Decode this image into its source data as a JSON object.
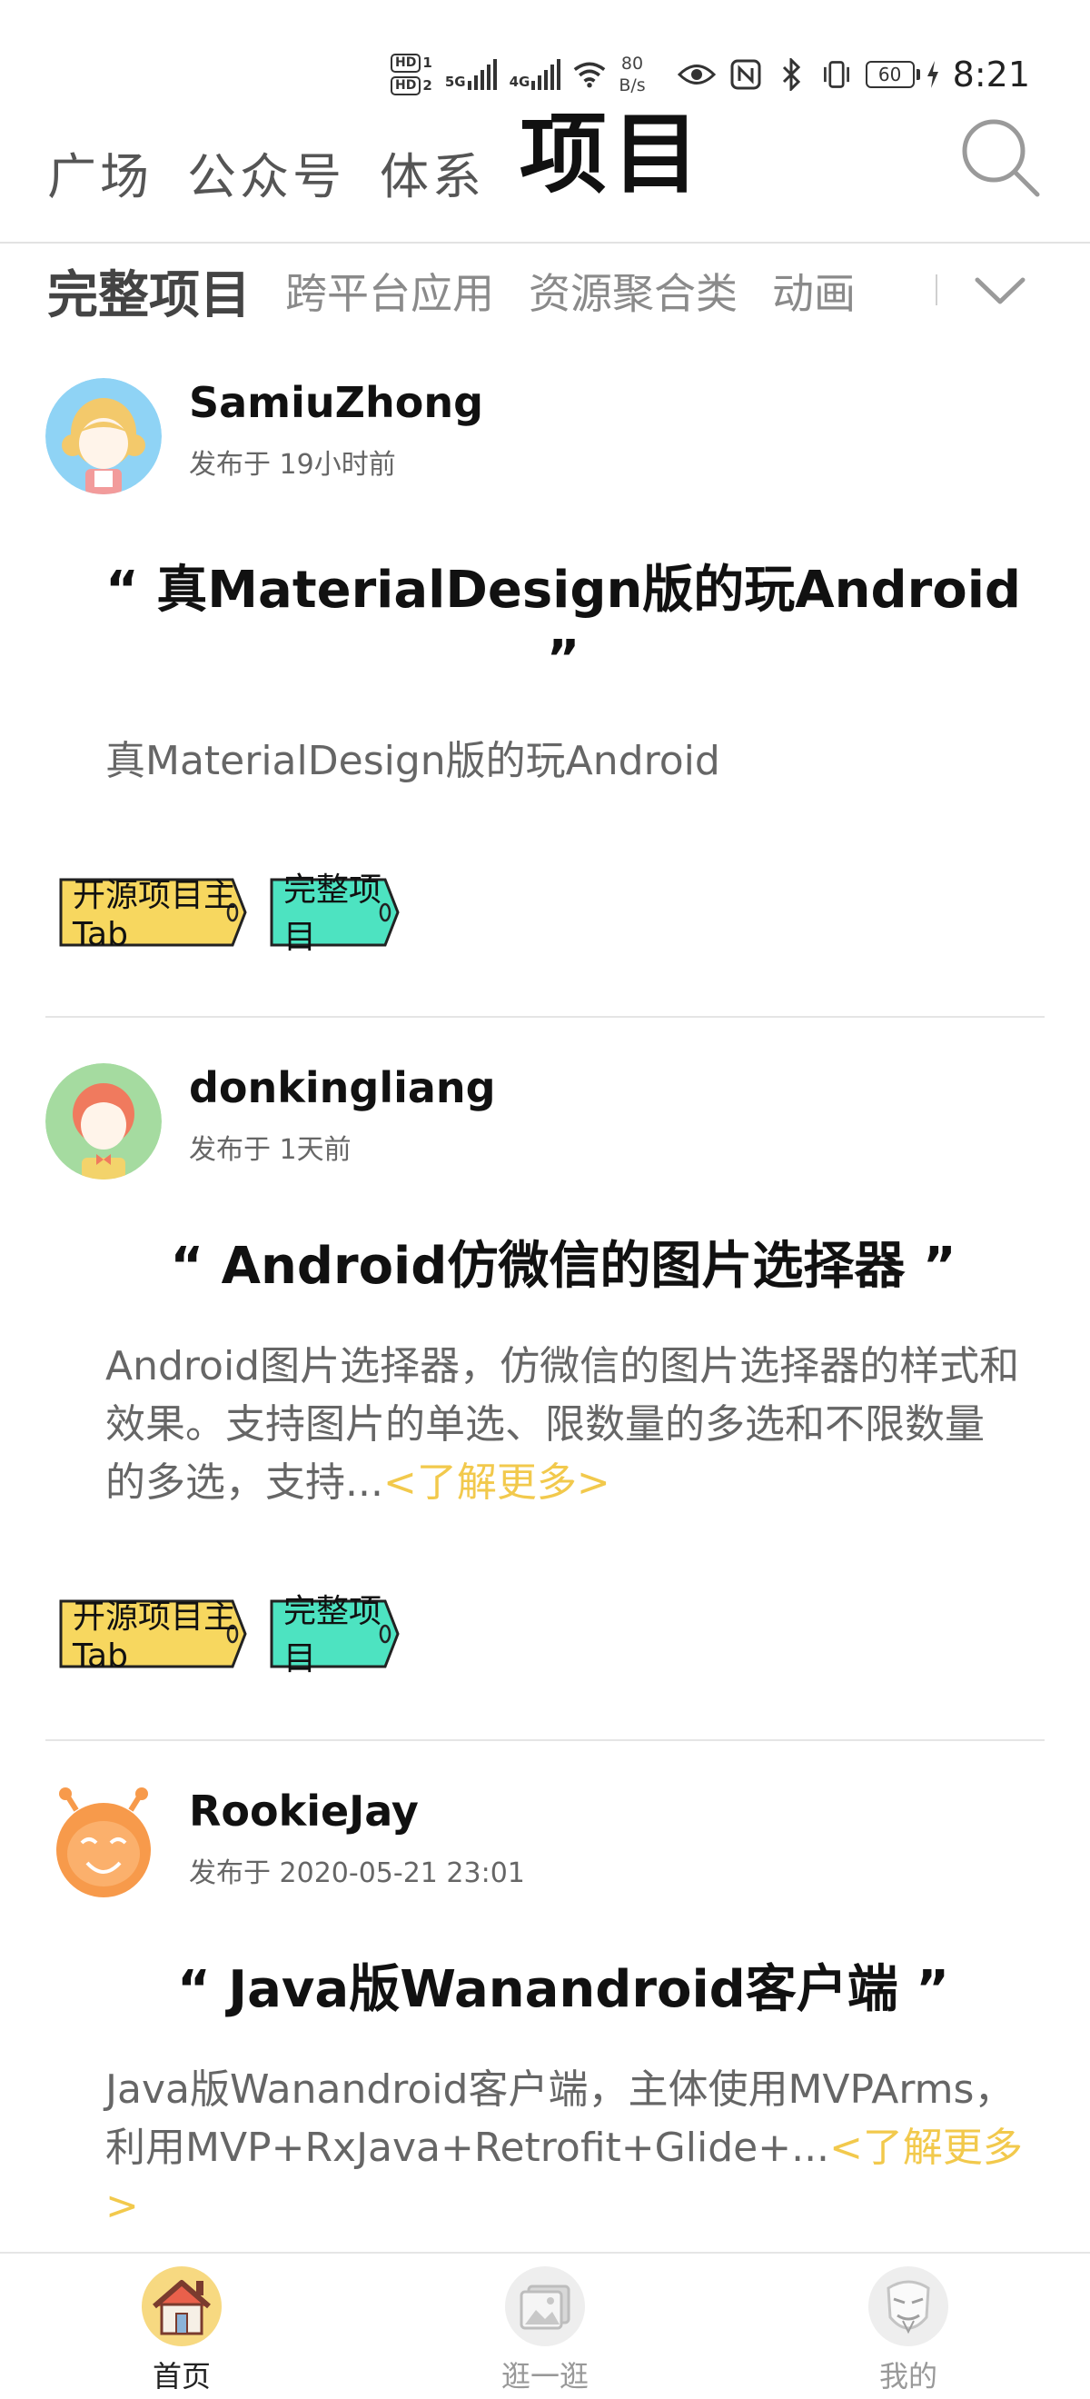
{
  "status_bar": {
    "hd1": "HD",
    "hd1_sub": "1",
    "hd2": "HD",
    "hd2_sub": "2",
    "sig1": "5G",
    "sig2": "4G",
    "net_speed": "80",
    "net_unit": "B/s",
    "battery": "60",
    "time": "8:21"
  },
  "top_nav": {
    "tabs": [
      "广场",
      "公众号",
      "体系",
      "项目"
    ],
    "active_index": 3
  },
  "sub_tabs": {
    "items": [
      "完整项目",
      "跨平台应用",
      "资源聚合类",
      "动画"
    ],
    "active_index": 0
  },
  "articles": [
    {
      "author": "SamiuZhong",
      "time": "发布于 19小时前",
      "title": "“ 真MaterialDesign版的玩Android ”",
      "desc": "真MaterialDesign版的玩Android",
      "more": "",
      "tags": [
        "开源项目主Tab",
        "完整项目"
      ]
    },
    {
      "author": "donkingliang",
      "time": "发布于 1天前",
      "title": "“ Android仿微信的图片选择器 ”",
      "desc": "Android图片选择器，仿微信的图片选择器的样式和效果。支持图片的单选、限数量的多选和不限数量的多选，支持...",
      "more": "<了解更多>",
      "tags": [
        "开源项目主Tab",
        "完整项目"
      ]
    },
    {
      "author": "RookieJay",
      "time": "发布于 2020-05-21 23:01",
      "title": "“ Java版Wanandroid客户端 ”",
      "desc": "Java版Wanandroid客户端，主体使用MVPArms，利用MVP+RxJava+Retrofit+Glide+...",
      "more": "<了解更多>",
      "tags": []
    }
  ],
  "bottom_nav": {
    "items": [
      "首页",
      "逛一逛",
      "我的"
    ],
    "active_index": 0
  },
  "colors": {
    "tag_yellow": "#f7d75f",
    "tag_teal": "#4de3c1",
    "more_link": "#f2c94c"
  }
}
